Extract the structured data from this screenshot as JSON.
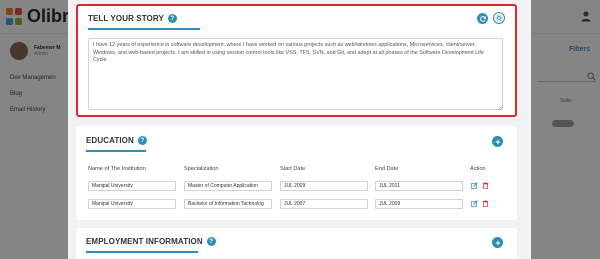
{
  "app": {
    "logo_text": "Olibr",
    "logo_colors": [
      "#f0862a",
      "#e84a4a",
      "#3fa9d8",
      "#7dbf4a"
    ],
    "user": {
      "name": "Fabemer M",
      "role": "Admin"
    },
    "sidebar_items": [
      {
        "label": "Dev Managemen"
      },
      {
        "label": "Blog"
      },
      {
        "label": "Email History"
      }
    ],
    "filters_label": "Filters",
    "skills_label": "Skills"
  },
  "modal": {
    "accent_color": "#2f8fb2",
    "highlight_color": "#e3262a",
    "story": {
      "title": "TELL YOUR STORY",
      "text": "I have 12 years of experience in software development, where I have worked on various projects such as web/windows applications, Microservices, client/server, Windows, and web-based projects. I am skilled in using version control tools like VSS, TFS, SVN, and Git, and adept at all phases of the Software Development Life Cycle."
    },
    "education": {
      "title": "EDUCATION",
      "columns": [
        "Name of The Institution",
        "Specialization",
        "Start Date",
        "End Date",
        "Action"
      ],
      "rows": [
        {
          "institution": "Manipal University",
          "specialization": "Master of Computer Application",
          "start": "JUL 2009",
          "end": "JUL 2011"
        },
        {
          "institution": "Manipal University",
          "specialization": "Bachelor of Information Technolog",
          "start": "JUL 2007",
          "end": "JUL 2009"
        }
      ]
    },
    "employment": {
      "title": "EMPLOYMENT INFORMATION"
    }
  }
}
